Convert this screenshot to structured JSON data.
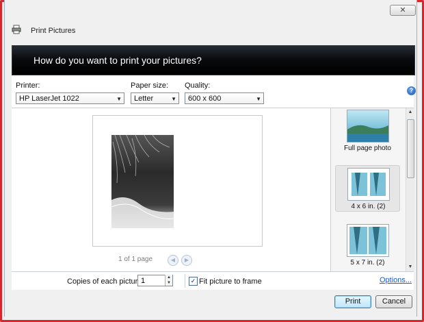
{
  "window": {
    "title": "Print Pictures",
    "close_glyph": "✕"
  },
  "banner": {
    "heading": "How do you want to print your pictures?"
  },
  "printer": {
    "label": "Printer:",
    "value": "HP LaserJet 1022"
  },
  "paper_size": {
    "label": "Paper size:",
    "value": "Letter"
  },
  "quality": {
    "label": "Quality:",
    "value": "600 x 600"
  },
  "help": {
    "glyph": "?"
  },
  "preview": {
    "page_count": "1 of 1 page",
    "prev_glyph": "◀",
    "next_glyph": "▶"
  },
  "layouts": {
    "items": [
      {
        "label": "Full page photo"
      },
      {
        "label": "4 x 6 in. (2)"
      },
      {
        "label": "5 x 7 in. (2)"
      }
    ],
    "selected_index": 1
  },
  "copies": {
    "label": "Copies of each picture:",
    "value": "1"
  },
  "fit_frame": {
    "label": "Fit picture to frame",
    "checked": true,
    "check_glyph": "✓"
  },
  "options_link": "Options...",
  "buttons": {
    "print": "Print",
    "cancel": "Cancel"
  },
  "icons": {
    "printer": "printer-icon",
    "help": "help-icon",
    "close": "close-icon"
  },
  "colors": {
    "banner_bg": "#000000",
    "link": "#1f58c8",
    "frame_border": "#d8262a"
  }
}
